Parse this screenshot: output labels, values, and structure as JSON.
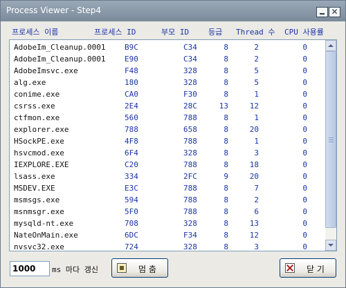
{
  "window": {
    "title": "Process Viewer - Step4"
  },
  "columns": {
    "name": "프로세스 이름",
    "pid": "프로세스 ID",
    "ppid": "부모 ID",
    "priority": "등급",
    "threads": "Thread 수",
    "cpu": "CPU 사용률"
  },
  "processes": [
    {
      "name": "AdobeIm_Cleanup.0001",
      "pid": "B9C",
      "ppid": "C34",
      "priority": "8",
      "threads": "2",
      "cpu": "0"
    },
    {
      "name": "AdobeIm_Cleanup.0001",
      "pid": "E90",
      "ppid": "C34",
      "priority": "8",
      "threads": "2",
      "cpu": "0"
    },
    {
      "name": "AdobeImsvc.exe",
      "pid": "F48",
      "ppid": "328",
      "priority": "8",
      "threads": "5",
      "cpu": "0"
    },
    {
      "name": "alg.exe",
      "pid": "180",
      "ppid": "328",
      "priority": "8",
      "threads": "5",
      "cpu": "0"
    },
    {
      "name": "conime.exe",
      "pid": "CA0",
      "ppid": "F30",
      "priority": "8",
      "threads": "1",
      "cpu": "0"
    },
    {
      "name": "csrss.exe",
      "pid": "2E4",
      "ppid": "28C",
      "priority": "13",
      "threads": "12",
      "cpu": "0"
    },
    {
      "name": "ctfmon.exe",
      "pid": "560",
      "ppid": "788",
      "priority": "8",
      "threads": "1",
      "cpu": "0"
    },
    {
      "name": "explorer.exe",
      "pid": "788",
      "ppid": "658",
      "priority": "8",
      "threads": "20",
      "cpu": "0"
    },
    {
      "name": "HSockPE.exe",
      "pid": "4F8",
      "ppid": "788",
      "priority": "8",
      "threads": "1",
      "cpu": "0"
    },
    {
      "name": "hsvcmod.exe",
      "pid": "6F4",
      "ppid": "328",
      "priority": "8",
      "threads": "3",
      "cpu": "0"
    },
    {
      "name": "IEXPLORE.EXE",
      "pid": "C20",
      "ppid": "788",
      "priority": "8",
      "threads": "18",
      "cpu": "0"
    },
    {
      "name": "lsass.exe",
      "pid": "334",
      "ppid": "2FC",
      "priority": "9",
      "threads": "20",
      "cpu": "0"
    },
    {
      "name": "MSDEV.EXE",
      "pid": "E3C",
      "ppid": "788",
      "priority": "8",
      "threads": "7",
      "cpu": "0"
    },
    {
      "name": "msmsgs.exe",
      "pid": "594",
      "ppid": "788",
      "priority": "8",
      "threads": "2",
      "cpu": "0"
    },
    {
      "name": "msnmsgr.exe",
      "pid": "5F0",
      "ppid": "788",
      "priority": "8",
      "threads": "6",
      "cpu": "0"
    },
    {
      "name": "mysqld-nt.exe",
      "pid": "708",
      "ppid": "328",
      "priority": "8",
      "threads": "13",
      "cpu": "0"
    },
    {
      "name": "NateOnMain.exe",
      "pid": "6DC",
      "ppid": "F34",
      "priority": "8",
      "threads": "12",
      "cpu": "0"
    },
    {
      "name": "nvsvc32.exe",
      "pid": "724",
      "ppid": "328",
      "priority": "8",
      "threads": "3",
      "cpu": "0"
    }
  ],
  "footer": {
    "interval_value": "1000",
    "interval_label": "ms 마다 갱신",
    "stop_label": "멈 춤",
    "close_label": "닫 기"
  }
}
